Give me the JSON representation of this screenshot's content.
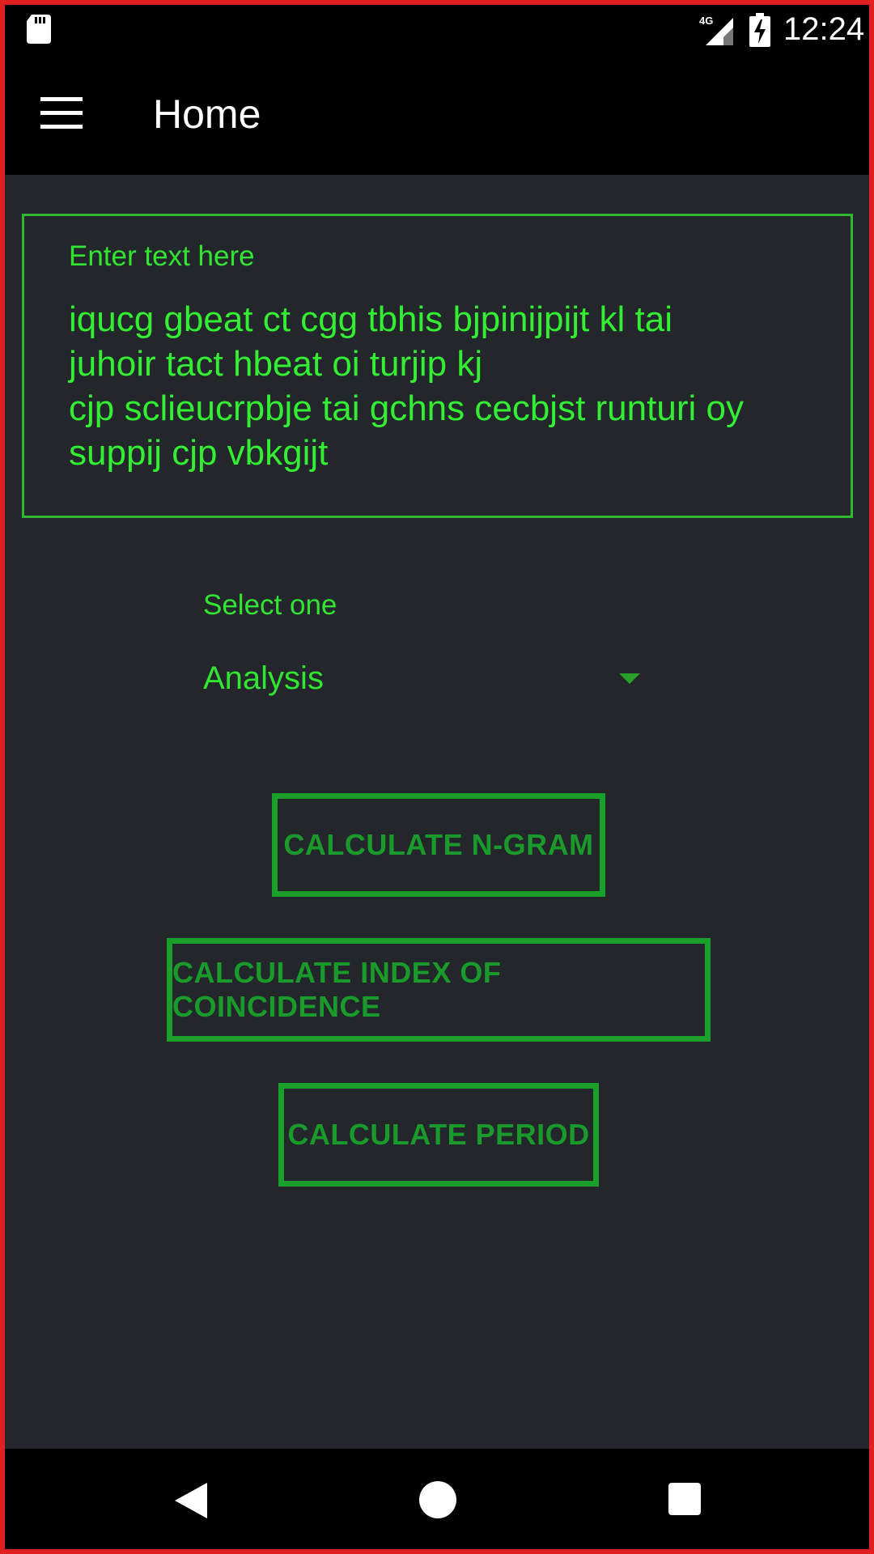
{
  "status_bar": {
    "time": "12:24",
    "network": "4G",
    "icons": [
      "sd-card-icon",
      "signal-icon",
      "battery-charging-icon"
    ]
  },
  "app_bar": {
    "title": "Home",
    "menu_icon": "menu-icon"
  },
  "text_input": {
    "label": "Enter text here",
    "value": "iqucg gbeat ct cgg tbhis bjpinijpijt kl tai\njuhoir tact hbeat oi turjip kj\ncjp sclieucrpbje tai gchns cecbjst runturi oy\nsuppij cjp vbkgijt"
  },
  "select": {
    "label": "Select one",
    "value": "Analysis"
  },
  "buttons": {
    "ngram": "CALCULATE N-GRAM",
    "ioc": "CALCULATE INDEX OF COINCIDENCE",
    "period": "CALCULATE PERIOD"
  },
  "nav_bar": {
    "icons": [
      "back-icon",
      "home-icon",
      "recents-icon"
    ]
  },
  "colors": {
    "accent": "#33e533",
    "button": "#1aa02a",
    "background": "#23262b",
    "bars": "#000000",
    "frame": "#e02020"
  }
}
